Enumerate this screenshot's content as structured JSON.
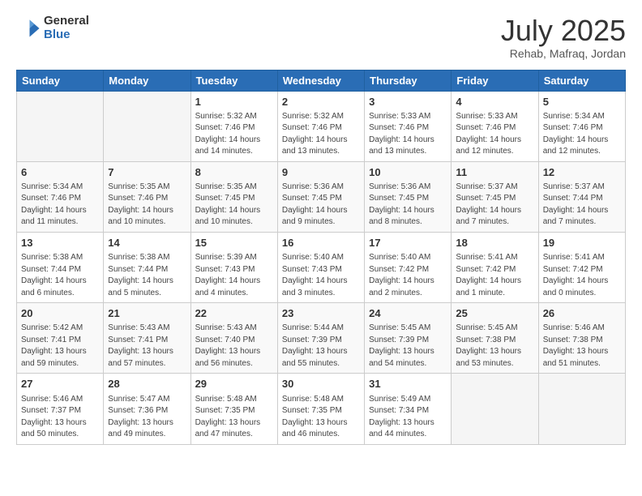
{
  "header": {
    "logo_general": "General",
    "logo_blue": "Blue",
    "title": "July 2025",
    "location": "Rehab, Mafraq, Jordan"
  },
  "days_of_week": [
    "Sunday",
    "Monday",
    "Tuesday",
    "Wednesday",
    "Thursday",
    "Friday",
    "Saturday"
  ],
  "weeks": [
    [
      {
        "day": "",
        "info": ""
      },
      {
        "day": "",
        "info": ""
      },
      {
        "day": "1",
        "info": "Sunrise: 5:32 AM\nSunset: 7:46 PM\nDaylight: 14 hours\nand 14 minutes."
      },
      {
        "day": "2",
        "info": "Sunrise: 5:32 AM\nSunset: 7:46 PM\nDaylight: 14 hours\nand 13 minutes."
      },
      {
        "day": "3",
        "info": "Sunrise: 5:33 AM\nSunset: 7:46 PM\nDaylight: 14 hours\nand 13 minutes."
      },
      {
        "day": "4",
        "info": "Sunrise: 5:33 AM\nSunset: 7:46 PM\nDaylight: 14 hours\nand 12 minutes."
      },
      {
        "day": "5",
        "info": "Sunrise: 5:34 AM\nSunset: 7:46 PM\nDaylight: 14 hours\nand 12 minutes."
      }
    ],
    [
      {
        "day": "6",
        "info": "Sunrise: 5:34 AM\nSunset: 7:46 PM\nDaylight: 14 hours\nand 11 minutes."
      },
      {
        "day": "7",
        "info": "Sunrise: 5:35 AM\nSunset: 7:46 PM\nDaylight: 14 hours\nand 10 minutes."
      },
      {
        "day": "8",
        "info": "Sunrise: 5:35 AM\nSunset: 7:45 PM\nDaylight: 14 hours\nand 10 minutes."
      },
      {
        "day": "9",
        "info": "Sunrise: 5:36 AM\nSunset: 7:45 PM\nDaylight: 14 hours\nand 9 minutes."
      },
      {
        "day": "10",
        "info": "Sunrise: 5:36 AM\nSunset: 7:45 PM\nDaylight: 14 hours\nand 8 minutes."
      },
      {
        "day": "11",
        "info": "Sunrise: 5:37 AM\nSunset: 7:45 PM\nDaylight: 14 hours\nand 7 minutes."
      },
      {
        "day": "12",
        "info": "Sunrise: 5:37 AM\nSunset: 7:44 PM\nDaylight: 14 hours\nand 7 minutes."
      }
    ],
    [
      {
        "day": "13",
        "info": "Sunrise: 5:38 AM\nSunset: 7:44 PM\nDaylight: 14 hours\nand 6 minutes."
      },
      {
        "day": "14",
        "info": "Sunrise: 5:38 AM\nSunset: 7:44 PM\nDaylight: 14 hours\nand 5 minutes."
      },
      {
        "day": "15",
        "info": "Sunrise: 5:39 AM\nSunset: 7:43 PM\nDaylight: 14 hours\nand 4 minutes."
      },
      {
        "day": "16",
        "info": "Sunrise: 5:40 AM\nSunset: 7:43 PM\nDaylight: 14 hours\nand 3 minutes."
      },
      {
        "day": "17",
        "info": "Sunrise: 5:40 AM\nSunset: 7:42 PM\nDaylight: 14 hours\nand 2 minutes."
      },
      {
        "day": "18",
        "info": "Sunrise: 5:41 AM\nSunset: 7:42 PM\nDaylight: 14 hours\nand 1 minute."
      },
      {
        "day": "19",
        "info": "Sunrise: 5:41 AM\nSunset: 7:42 PM\nDaylight: 14 hours\nand 0 minutes."
      }
    ],
    [
      {
        "day": "20",
        "info": "Sunrise: 5:42 AM\nSunset: 7:41 PM\nDaylight: 13 hours\nand 59 minutes."
      },
      {
        "day": "21",
        "info": "Sunrise: 5:43 AM\nSunset: 7:41 PM\nDaylight: 13 hours\nand 57 minutes."
      },
      {
        "day": "22",
        "info": "Sunrise: 5:43 AM\nSunset: 7:40 PM\nDaylight: 13 hours\nand 56 minutes."
      },
      {
        "day": "23",
        "info": "Sunrise: 5:44 AM\nSunset: 7:39 PM\nDaylight: 13 hours\nand 55 minutes."
      },
      {
        "day": "24",
        "info": "Sunrise: 5:45 AM\nSunset: 7:39 PM\nDaylight: 13 hours\nand 54 minutes."
      },
      {
        "day": "25",
        "info": "Sunrise: 5:45 AM\nSunset: 7:38 PM\nDaylight: 13 hours\nand 53 minutes."
      },
      {
        "day": "26",
        "info": "Sunrise: 5:46 AM\nSunset: 7:38 PM\nDaylight: 13 hours\nand 51 minutes."
      }
    ],
    [
      {
        "day": "27",
        "info": "Sunrise: 5:46 AM\nSunset: 7:37 PM\nDaylight: 13 hours\nand 50 minutes."
      },
      {
        "day": "28",
        "info": "Sunrise: 5:47 AM\nSunset: 7:36 PM\nDaylight: 13 hours\nand 49 minutes."
      },
      {
        "day": "29",
        "info": "Sunrise: 5:48 AM\nSunset: 7:35 PM\nDaylight: 13 hours\nand 47 minutes."
      },
      {
        "day": "30",
        "info": "Sunrise: 5:48 AM\nSunset: 7:35 PM\nDaylight: 13 hours\nand 46 minutes."
      },
      {
        "day": "31",
        "info": "Sunrise: 5:49 AM\nSunset: 7:34 PM\nDaylight: 13 hours\nand 44 minutes."
      },
      {
        "day": "",
        "info": ""
      },
      {
        "day": "",
        "info": ""
      }
    ]
  ]
}
